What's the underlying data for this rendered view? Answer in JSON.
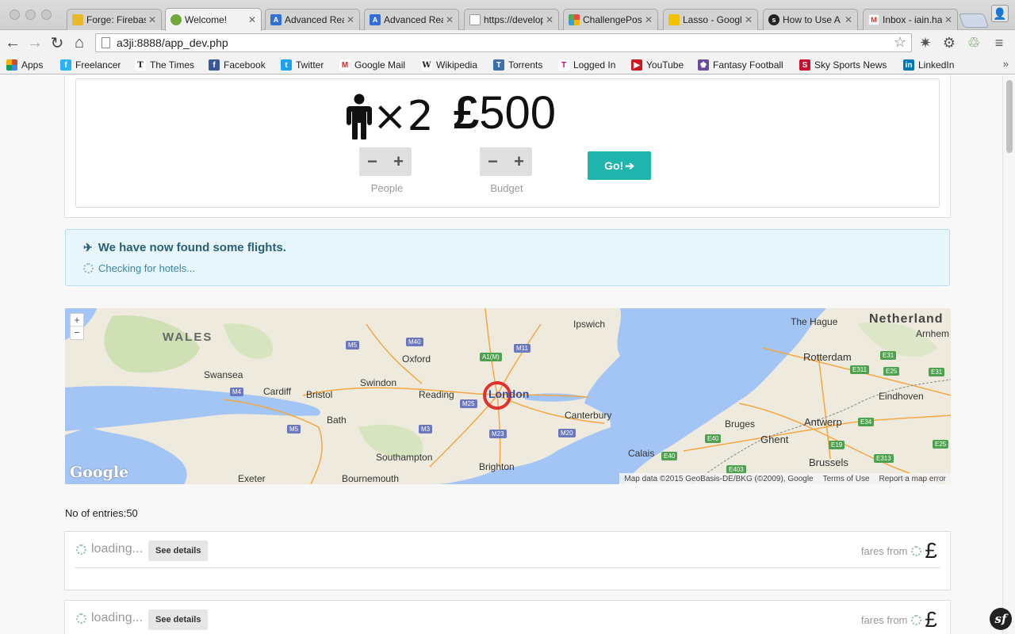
{
  "browser": {
    "tabs": [
      {
        "title": "Forge: Firebase",
        "favicon_color": "#e8b92b"
      },
      {
        "title": "Welcome!",
        "favicon_color": "#6fa83b",
        "active": true
      },
      {
        "title": "Advanced React",
        "favicon_color": "#2f6fd6"
      },
      {
        "title": "Advanced React",
        "favicon_color": "#2f6fd6"
      },
      {
        "title": "https://developer",
        "favicon_color": "#ffffff"
      },
      {
        "title": "ChallengePost",
        "favicon_color": "#e84a3c"
      },
      {
        "title": "Lasso - Google",
        "favicon_color": "#f2c200"
      },
      {
        "title": "How to Use A",
        "favicon_color": "#222222"
      },
      {
        "title": "Inbox - iain.ha",
        "favicon_color": "#d93025"
      }
    ],
    "url": "a3ji:8888/app_dev.php",
    "bookmarks": [
      {
        "label": "Apps",
        "icon_color": "#d14836"
      },
      {
        "label": "Freelancer",
        "icon_color": "#29b2fe"
      },
      {
        "label": "The Times",
        "icon_color": "#222222"
      },
      {
        "label": "Facebook",
        "icon_color": "#3b5998"
      },
      {
        "label": "Twitter",
        "icon_color": "#1da1f2"
      },
      {
        "label": "Google Mail",
        "icon_color": "#d93025"
      },
      {
        "label": "Wikipedia",
        "icon_color": "#555555"
      },
      {
        "label": "Torrents",
        "icon_color": "#3a6fb0"
      },
      {
        "label": "Logged In",
        "icon_color": "#e20074"
      },
      {
        "label": "YouTube",
        "icon_color": "#cc181e"
      },
      {
        "label": "Fantasy Football",
        "icon_color": "#6a4c9c"
      },
      {
        "label": "Sky Sports News",
        "icon_color": "#c8102e"
      },
      {
        "label": "LinkedIn",
        "icon_color": "#0077b5"
      }
    ]
  },
  "search": {
    "people_count": "×2",
    "budget_currency": "£",
    "budget_amount": "500",
    "decrement_label": "−",
    "increment_label": "+",
    "people_label": "People",
    "budget_label": "Budget",
    "go_label": "Go!"
  },
  "alert": {
    "title": "We have now found some flights.",
    "subtitle": "Checking for hotels..."
  },
  "map": {
    "places": {
      "wales": "WALES",
      "netherlands": "Netherland",
      "the_hague": "The Hague",
      "arnhem": "Arnhem",
      "ipswich": "Ipswich",
      "oxford": "Oxford",
      "swindon": "Swindon",
      "reading": "Reading",
      "swansea": "Swansea",
      "cardiff": "Cardiff",
      "bristol": "Bristol",
      "bath": "Bath",
      "southampton": "Southampton",
      "bournemouth": "Bournemouth",
      "exeter": "Exeter",
      "brighton": "Brighton",
      "canterbury": "Canterbury",
      "calais": "Calais",
      "bruges": "Bruges",
      "ghent": "Ghent",
      "antwerp": "Antwerp",
      "brussels": "Brussels",
      "rotterdam": "Rotterdam",
      "eindhoven": "Eindhoven",
      "london": "London"
    },
    "roads": [
      "M5",
      "M40",
      "M11",
      "A1(M)",
      "M4",
      "M5",
      "M25",
      "M3",
      "M23",
      "M20",
      "E31",
      "E311",
      "E25",
      "E31",
      "E34",
      "E40",
      "E19",
      "E313",
      "E403",
      "E40",
      "E25"
    ],
    "zoom_in": "+",
    "zoom_out": "−",
    "logo": "Google",
    "attribution": "Map data ©2015 GeoBasis-DE/BKG (©2009), Google",
    "terms": "Terms of Use",
    "report": "Report a map error"
  },
  "results": {
    "entries_text": "No of entries:50",
    "items": [
      {
        "status": "loading...",
        "details_label": "See details",
        "fares_label": "fares from",
        "currency": "£"
      },
      {
        "status": "loading...",
        "details_label": "See details",
        "fares_label": "fares from",
        "currency": "£"
      }
    ]
  }
}
